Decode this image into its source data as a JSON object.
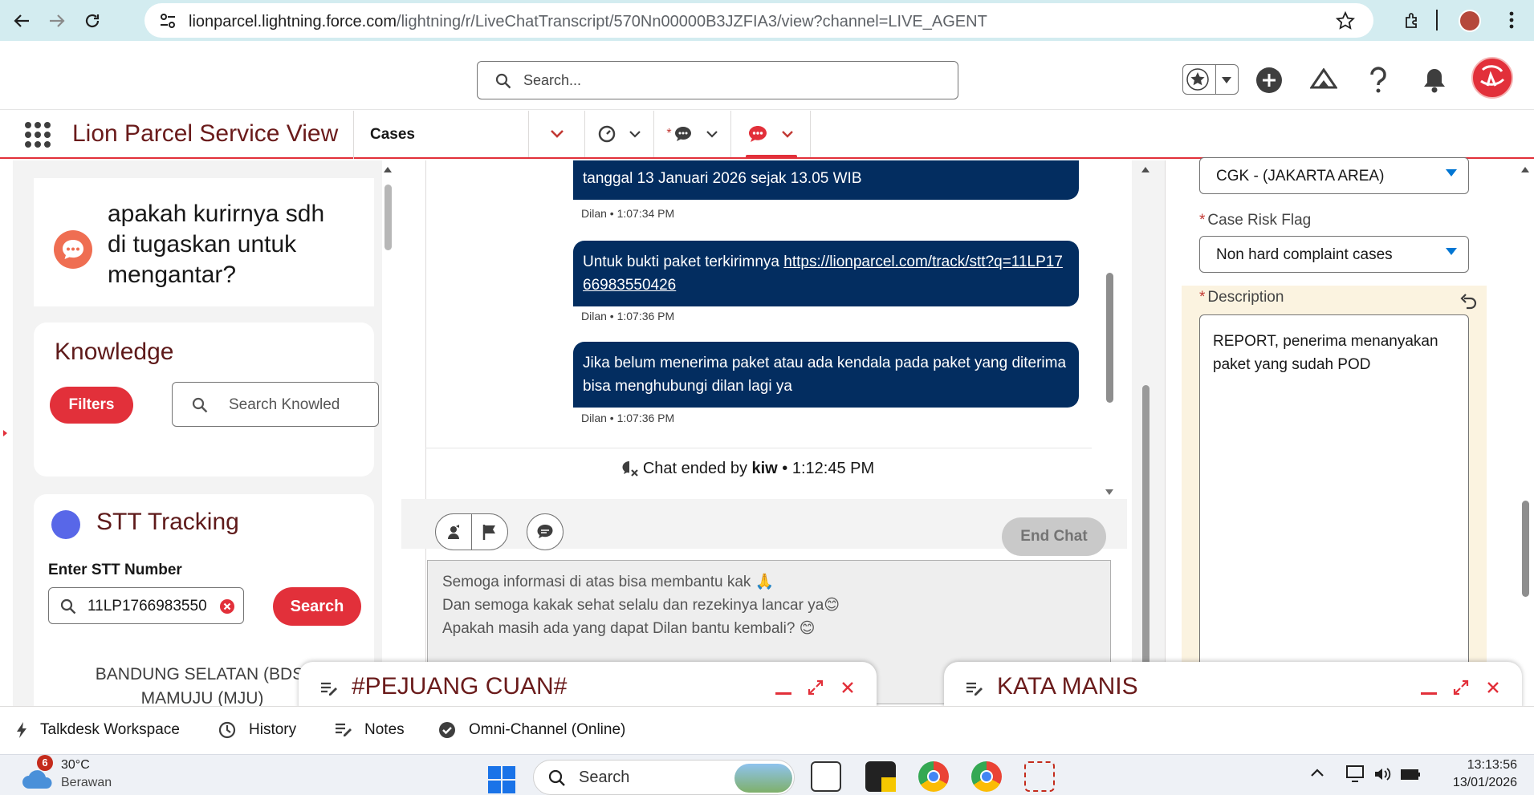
{
  "browser": {
    "url_host": "lionparcel.lightning.force.com",
    "url_path": "/lightning/r/LiveChatTranscript/570Nn00000B3JZFIA3/view?channel=LIVE_AGENT"
  },
  "header": {
    "search_placeholder": "Search..."
  },
  "app_nav": {
    "app_name": "Lion Parcel Service View",
    "cases_tab": "Cases"
  },
  "left": {
    "question": "apakah kurirnya sdh di tugaskan untuk mengantar?",
    "knowledge": {
      "title": "Knowledge",
      "filters_label": "Filters",
      "search_placeholder": "Search Knowled"
    },
    "stt": {
      "title": "STT Tracking",
      "label": "Enter STT Number",
      "value": "11LP1766983550",
      "search_label": "Search",
      "result_line1": "BANDUNG SELATAN (BDS)",
      "result_line2": "MAMUJU (MJU)"
    }
  },
  "chat": {
    "messages": [
      {
        "text": "tanggal 13 Januari 2026 sejak 13.05 WIB",
        "meta": "Dilan • 1:07:34 PM"
      },
      {
        "text_prefix": "Untuk bukti paket terkirimnya ",
        "link": "https://lionparcel.com/track/stt?q=11LP1766983550426",
        "meta": "Dilan • 1:07:36 PM"
      },
      {
        "text": "Jika belum menerima paket atau ada kendala pada paket yang diterima bisa menghubungi dilan lagi ya",
        "meta": "Dilan • 1:07:36 PM"
      }
    ],
    "ended_prefix": "Chat ended by ",
    "ended_by": "kiw",
    "ended_time": " • 1:12:45 PM",
    "end_chat_label": "End Chat",
    "composer_lines": [
      "Semoga informasi di atas bisa membantu kak 🙏",
      "Dan semoga kakak sehat selalu dan rezekinya lancar ya😊",
      "Apakah masih ada yang dapat Dilan bantu kembali? 😊"
    ]
  },
  "right": {
    "area_value": "CGK - (JAKARTA AREA)",
    "risk_label": "Case Risk Flag",
    "risk_value": "Non hard complaint cases",
    "description_label": "Description",
    "description_value": "REPORT, penerima menanyakan paket yang sudah POD"
  },
  "docked": {
    "left_title": "#PEJUANG CUAN#",
    "right_title": "KATA MANIS"
  },
  "utility_bar": {
    "items": [
      "Talkdesk Workspace",
      "History",
      "Notes",
      "Omni-Channel (Online)"
    ]
  },
  "taskbar": {
    "weather_badge": "6",
    "temperature": "30°C",
    "weather_text": "Berawan",
    "search_placeholder": "Search",
    "time": "13:13:56",
    "date": "13/01/2026"
  }
}
